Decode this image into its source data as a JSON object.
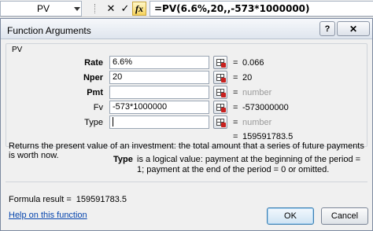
{
  "formula_bar": {
    "name_box": "PV",
    "cancel_glyph": "✕",
    "enter_glyph": "✓",
    "fx_label": "fx",
    "formula": "=PV(6.6%,20,,-573*1000000)"
  },
  "dialog": {
    "title": "Function Arguments",
    "help_button": "?",
    "close_button": "✕",
    "function_name": "PV",
    "args": [
      {
        "label": "Rate",
        "bold": true,
        "value": "6.6%",
        "result": "0.066",
        "result_muted": false
      },
      {
        "label": "Nper",
        "bold": true,
        "value": "20",
        "result": "20",
        "result_muted": false
      },
      {
        "label": "Pmt",
        "bold": true,
        "value": "",
        "result": "number",
        "result_muted": true
      },
      {
        "label": "Fv",
        "bold": false,
        "value": "-573*1000000",
        "result": "-573000000",
        "result_muted": false
      },
      {
        "label": "Type",
        "bold": false,
        "value": "",
        "result": "number",
        "result_muted": true
      }
    ],
    "result_equals": "=",
    "result_value": "159591783.5",
    "description": "Returns the present value of an investment: the total amount that a series of future payments is worth now.",
    "param_name": "Type",
    "param_description": "is a logical value: payment at the beginning of the period = 1; payment at the end of the period = 0 or omitted.",
    "formula_result_label": "Formula result =",
    "formula_result_value": "159591783.5",
    "help_link": "Help on this function",
    "ok_label": "OK",
    "cancel_label": "Cancel"
  },
  "icons": {
    "collapse": "collapse-dialog-icon",
    "fx": "insert-function-icon"
  }
}
